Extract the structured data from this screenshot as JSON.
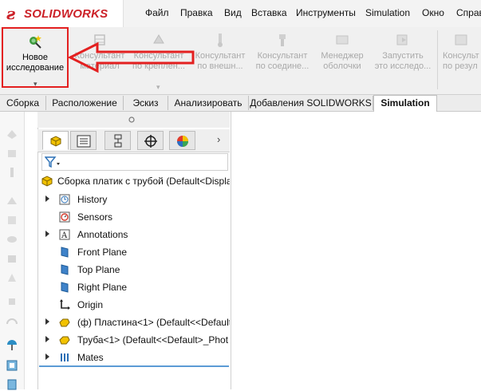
{
  "app": {
    "logo_text": "SOLIDWORKS",
    "logo_mark": "ƨ",
    "accent_color": "#cc2229"
  },
  "menu": {
    "items": [
      "Файл",
      "Правка",
      "Вид",
      "Вставка",
      "Инструменты",
      "Simulation",
      "Окно",
      "Справ"
    ]
  },
  "ribbon": {
    "new_study": "Новое\nисследование",
    "buttons": [
      "Консультант\nматериал",
      "Консультант\nпо креплен...",
      "Консультант\nпо внешн...",
      "Консультант\nпо соедине...",
      "Менеджер\nоболочки",
      "Запустить\nэто исследо...",
      "Консульт\nпо резул"
    ]
  },
  "tabs": [
    "Сборка",
    "Расположение",
    "Эскиз",
    "Анализировать",
    "Добавления SOLIDWORKS",
    "Simulation"
  ],
  "active_tab": "Simulation",
  "feature_tree": {
    "root": "Сборка платик с трубой  (Default<Display",
    "items": [
      {
        "label": "History",
        "icon": "history-icon",
        "expandable": true
      },
      {
        "label": "Sensors",
        "icon": "sensors-icon",
        "expandable": false
      },
      {
        "label": "Annotations",
        "icon": "annotations-icon",
        "expandable": true
      },
      {
        "label": "Front Plane",
        "icon": "plane-icon",
        "expandable": false
      },
      {
        "label": "Top Plane",
        "icon": "plane-icon",
        "expandable": false
      },
      {
        "label": "Right Plane",
        "icon": "plane-icon",
        "expandable": false
      },
      {
        "label": "Origin",
        "icon": "origin-icon",
        "expandable": false
      },
      {
        "label": "(ф) Пластина<1> (Default<<Default",
        "icon": "part-icon",
        "expandable": true
      },
      {
        "label": "Труба<1> (Default<<Default>_Phot",
        "icon": "part-icon",
        "expandable": true
      },
      {
        "label": "Mates",
        "icon": "mates-icon",
        "expandable": true
      }
    ]
  },
  "colors": {
    "highlight": "#e32020",
    "tree_line": "#5b9bd5",
    "part_yellow": "#e8b800"
  }
}
